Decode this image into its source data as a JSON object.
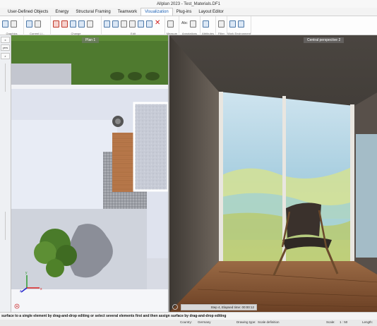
{
  "window": {
    "title": "Allplan 2023 - Test_Materials.DF1"
  },
  "ribbon_tabs": [
    "User-Defined Objects",
    "Energy",
    "Structural Framing",
    "Teamwork",
    "Visualization",
    "Plug-ins",
    "Layout Editor"
  ],
  "active_tab": "Visualization",
  "ribbon_groups": [
    "Graphics",
    "Current Li...",
    "Change",
    "Edit",
    "Measure",
    "Annotations",
    "Attributes",
    "Filter",
    "Work Environment"
  ],
  "left_panel": {
    "close_label": "x",
    "item_label": "yers"
  },
  "viewports": {
    "plan": {
      "label": "Plan 1"
    },
    "perspective": {
      "label": "Central perspective 2",
      "render_status": "Step 4, Elapsed time: 00:00:12"
    }
  },
  "hint": "surface to a single element by drag-and-drop editing or select several elements first and then assign surface by drag-and-drop editing",
  "statusbar": {
    "country_label": "Country:",
    "country_value": "Germany",
    "drawing_type_label": "Drawing type:",
    "drawing_type_value": "Scale definition",
    "scale_label": "Scale:",
    "scale_value": "1 : 50",
    "length_label": "Length:"
  },
  "colors": {
    "accent": "#1a5fb4",
    "ribbon_bg": "#fdfdfd",
    "grass": "#4f7a2f",
    "floor_wood": "#b8784a"
  },
  "icons": [
    "sun-icon",
    "settings-icon",
    "materials-icon",
    "pen-icon",
    "copy-icon",
    "delete-icon",
    "measure-icon",
    "text-icon",
    "attributes-icon",
    "filter-icon",
    "work-environment-icon"
  ]
}
